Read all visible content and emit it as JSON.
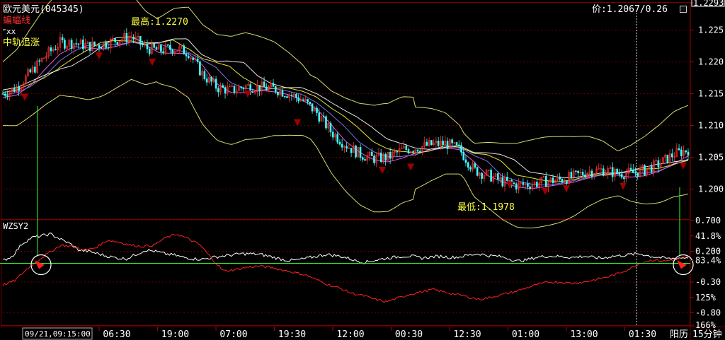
{
  "window": {
    "instrument": "欧元美元(045345)",
    "price_readout": "价:1.2067/0.26"
  },
  "indicators": {
    "main": [
      {
        "name": "蝙蝠线",
        "color": "#ff3030"
      },
      {
        "name": "xx",
        "color": "#ffffff"
      },
      {
        "name": "中轨追涨",
        "color": "#ffff40"
      }
    ],
    "sub_name": "WZSY2"
  },
  "annotations": {
    "high_label": "最高:1.2270",
    "low_label": "最低:1.1978"
  },
  "bottom_bar": {
    "start_time": "09/21,09:15:00",
    "calendar_button": "阳历",
    "period_button": "15分钟"
  },
  "chart_data": [
    {
      "type": "candlestick",
      "ylim": [
        1.1955,
        1.2293
      ],
      "y_ticks": [
        "1.2293",
        "1.225",
        "1.220",
        "1.215",
        "1.210",
        "1.205",
        "1.200"
      ],
      "x_tick_labels": [
        "06:30",
        "19:00",
        "07:00",
        "19:30",
        "12:00",
        "00:30",
        "12:30",
        "01:00",
        "13:00",
        "01:30"
      ],
      "grid": true,
      "high": 1.227,
      "low": 1.1978,
      "mid_trend": [
        1.215,
        1.216,
        1.2185,
        1.221,
        1.223,
        1.223,
        1.2225,
        1.2228,
        1.2235,
        1.224,
        1.2222,
        1.2218,
        1.2222,
        1.2215,
        1.218,
        1.216,
        1.2155,
        1.2162,
        1.216,
        1.2158,
        1.215,
        1.214,
        1.212,
        1.209,
        1.207,
        1.2055,
        1.2048,
        1.205,
        1.2062,
        1.2065,
        1.207,
        1.2072,
        1.2062,
        1.203,
        1.2022,
        1.2012,
        1.2006,
        1.2008,
        1.2012,
        1.2015,
        1.202,
        1.2028,
        1.203,
        1.2025,
        1.2025,
        1.203,
        1.204,
        1.2055,
        1.2062
      ]
    },
    {
      "type": "line",
      "name": "WZSY2",
      "y_ticks": [
        "0.700",
        "41.8%",
        "0.200",
        "83.4%",
        "-0.30",
        "125%",
        "-0.80",
        "166%"
      ],
      "grid": true,
      "series": [
        {
          "name": "white",
          "color": "#ffffff",
          "values": [
            0.05,
            0.12,
            0.32,
            0.42,
            0.45,
            0.48,
            0.4,
            0.33,
            0.22,
            0.2,
            0.16,
            0.12,
            0.09,
            0.08,
            0.15,
            0.22,
            0.2,
            0.16,
            0.14,
            0.1,
            0.08,
            0.07,
            0.1,
            0.12,
            0.14,
            0.16,
            0.16,
            0.15,
            0.12,
            0.08,
            0.05,
            0.06,
            0.09,
            0.12,
            0.15,
            0.13,
            0.1,
            0.05,
            0.02,
            0.05,
            0.08,
            0.1,
            0.12,
            0.12,
            0.09,
            0.11,
            0.12,
            0.1,
            0.11,
            0.14,
            0.16,
            0.13,
            0.12,
            0.09,
            0.04,
            0.06,
            0.1,
            0.12,
            0.12,
            0.11,
            0.1,
            0.12,
            0.1,
            0.09,
            0.12,
            0.13,
            0.15,
            0.16,
            0.12,
            0.1,
            0.08,
            0.09,
            0.1
          ]
        },
        {
          "name": "red",
          "color": "#ff2020",
          "values": [
            -0.35,
            -0.28,
            -0.1,
            0.05,
            0.18,
            0.3,
            0.28,
            0.22,
            0.26,
            0.38,
            0.35,
            0.3,
            0.28,
            0.3,
            0.42,
            0.48,
            0.4,
            0.3,
            0.08,
            -0.12,
            -0.1,
            -0.06,
            -0.04,
            -0.06,
            -0.1,
            -0.14,
            -0.18,
            -0.26,
            -0.34,
            -0.4,
            -0.48,
            -0.52,
            -0.58,
            -0.62,
            -0.56,
            -0.5,
            -0.46,
            -0.42,
            -0.46,
            -0.5,
            -0.54,
            -0.58,
            -0.55,
            -0.5,
            -0.46,
            -0.4,
            -0.34,
            -0.3,
            -0.3,
            -0.32,
            -0.3,
            -0.26,
            -0.22,
            -0.16,
            -0.08,
            0.02,
            0.06,
            0.04,
            0.08,
            0.1
          ]
        }
      ],
      "reference_level": 0.12
    }
  ]
}
